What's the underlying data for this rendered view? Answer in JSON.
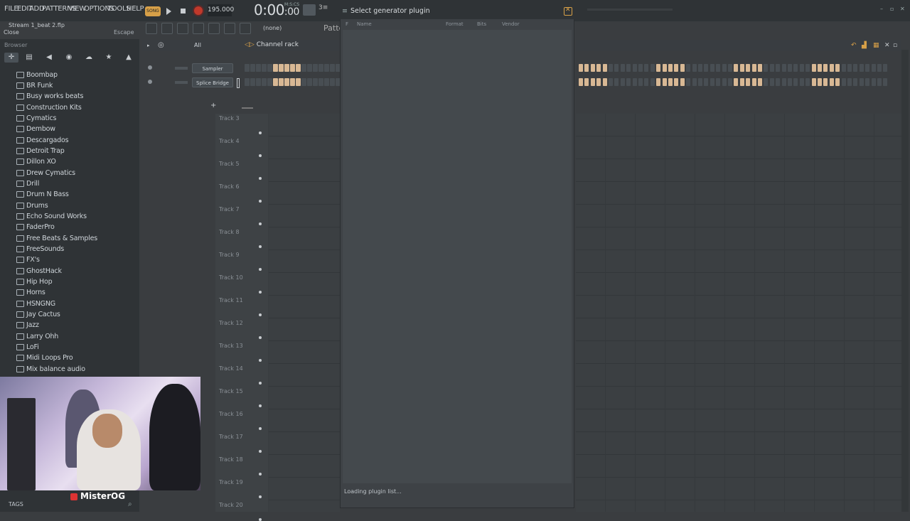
{
  "menu": [
    "FILE",
    "EDIT",
    "ADD",
    "PATTERNS",
    "VIEW",
    "OPTIONS",
    "TOOLS",
    "HELP"
  ],
  "transport": {
    "song_label": "SONG",
    "tempo": "195.000",
    "time": "0:00",
    "time_frac": ":00",
    "time_unit": "M:S:CS",
    "pattern_selector": "(none)",
    "pattern_label": "Patte"
  },
  "file": {
    "name": "Stream 1_beat 2.flp",
    "hint_action": "Close",
    "hint_key": "Escape"
  },
  "browser": {
    "title": "Browser",
    "folders": [
      "Boombap",
      "BR Funk",
      "Busy works beats",
      "Construction Kits",
      "Cymatics",
      "Dembow",
      "Descargados",
      "Detroit Trap",
      "Dillon XO",
      "Drew Cymatics",
      "Drill",
      "Drum N Bass",
      "Drums",
      "Echo Sound Works",
      "FaderPro",
      "Free Beats & Samples",
      "FreeSounds",
      "FX's",
      "GhostHack",
      "Hip Hop",
      "Horns",
      "HSNGNG",
      "Jay Cactus",
      "Jazz",
      "Larry Ohh",
      "LoFi",
      "Midi Loops Pro",
      "Mix balance audio"
    ]
  },
  "channel_rack": {
    "filter": "All",
    "title": "Channel rack",
    "channels": [
      "Sampler",
      "Splice Bridge"
    ]
  },
  "playlist": {
    "tracks": [
      "Track 3",
      "Track 4",
      "Track 5",
      "Track 6",
      "Track 7",
      "Track 8",
      "Track 9",
      "Track 10",
      "Track 11",
      "Track 12",
      "Track 13",
      "Track 14",
      "Track 15",
      "Track 16",
      "Track 17",
      "Track 18",
      "Track 19",
      "Track 20"
    ]
  },
  "dialog": {
    "title": "Select generator plugin",
    "columns": {
      "f": "F",
      "name": "Name",
      "format": "Format",
      "bits": "Bits",
      "vendor": "Vendor"
    },
    "status": "Loading plugin list..."
  },
  "overlay": {
    "streamer_name": "MisterOG",
    "tags_label": "TAGS"
  },
  "colors": {
    "accent": "#d7a048",
    "record": "#c0392b",
    "step_on": "#d8b894",
    "panel_bg": "#2f3336"
  }
}
